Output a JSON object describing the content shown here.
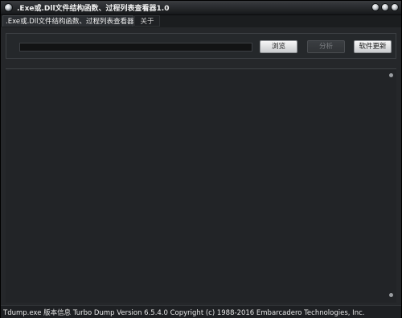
{
  "window": {
    "title": ".Exe或.Dll文件结构函数、过程列表查看器1.0"
  },
  "tabs": [
    {
      "label": ".Exe或.Dll文件结构函数、过程列表查看器",
      "active": true
    },
    {
      "label": "关于",
      "active": false
    }
  ],
  "toolbar": {
    "path_value": "",
    "browse_label": "浏览",
    "analyze_label": "分析",
    "update_label": "软件更新"
  },
  "statusbar": {
    "text": "Tdump.exe 版本信息 Turbo Dump  Version 6.5.4.0 Copyright (c) 1988-2016 Embarcadero Technologies, Inc."
  },
  "icons": {
    "app": "app-logo-icon",
    "minimize": "minimize-icon",
    "maximize": "maximize-icon",
    "close": "close-icon"
  }
}
